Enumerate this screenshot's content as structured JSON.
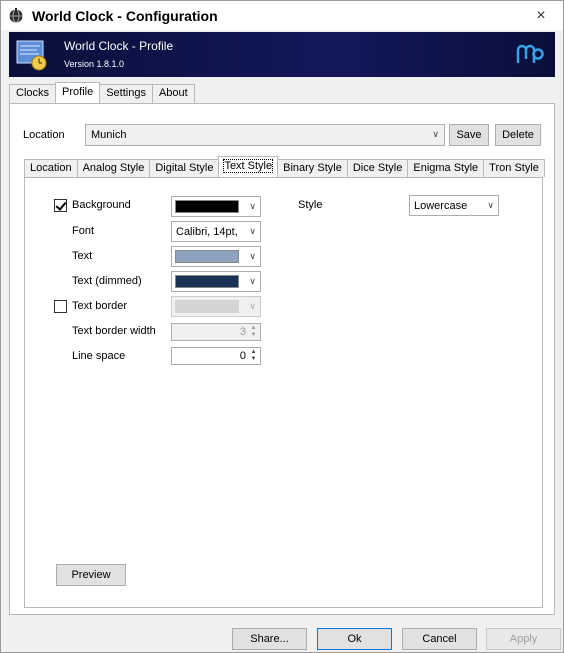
{
  "window": {
    "title": "World Clock - Configuration",
    "close_glyph": "×"
  },
  "banner": {
    "title": "World Clock - Profile",
    "version": "Version 1.8.1.0",
    "logo_icon": "mp-logo-icon"
  },
  "main_tabs": [
    {
      "label": "Clocks"
    },
    {
      "label": "Profile"
    },
    {
      "label": "Settings"
    },
    {
      "label": "About"
    }
  ],
  "profile": {
    "location_label": "Location",
    "location_value": "Munich",
    "save_label": "Save",
    "delete_label": "Delete"
  },
  "sub_tabs": [
    {
      "label": "Location"
    },
    {
      "label": "Analog Style"
    },
    {
      "label": "Digital Style"
    },
    {
      "label": "Text Style"
    },
    {
      "label": "Binary Style"
    },
    {
      "label": "Dice Style"
    },
    {
      "label": "Enigma Style"
    },
    {
      "label": "Tron Style"
    }
  ],
  "text_style": {
    "background_label": "Background",
    "background_checked": true,
    "background_color": "#000000",
    "font_label": "Font",
    "font_value": "Calibri, 14pt,",
    "text_label": "Text",
    "text_color": "#8fa3c0",
    "text_dimmed_label": "Text (dimmed)",
    "text_dimmed_color": "#1b3257",
    "text_border_label": "Text border",
    "text_border_checked": false,
    "text_border_color": "#d4d4d4",
    "text_border_width_label": "Text border width",
    "text_border_width_value": "3",
    "line_space_label": "Line space",
    "line_space_value": "0",
    "style_label": "Style",
    "style_value": "Lowercase",
    "preview_label": "Preview"
  },
  "footer": {
    "share_label": "Share...",
    "ok_label": "Ok",
    "cancel_label": "Cancel",
    "apply_label": "Apply"
  }
}
